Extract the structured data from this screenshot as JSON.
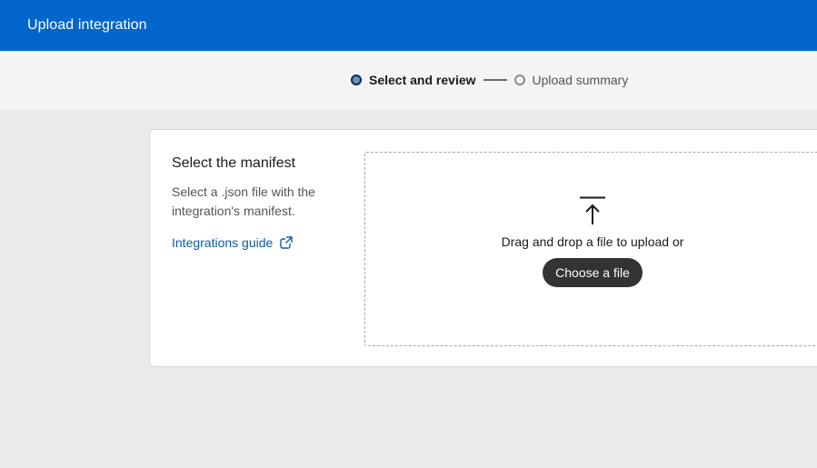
{
  "header": {
    "title": "Upload integration"
  },
  "steps": [
    {
      "label": "Select and review",
      "state": "active"
    },
    {
      "label": "Upload summary",
      "state": "inactive"
    }
  ],
  "manifest": {
    "title": "Select the manifest",
    "description": "Select a .json file with the integration's manifest.",
    "guide_link": "Integrations guide"
  },
  "dropzone": {
    "prompt": "Drag and drop a file to upload or",
    "button_label": "Choose a file"
  },
  "colors": {
    "header_bg": "#0066cc",
    "link": "#0b5cad",
    "button_bg": "#333333"
  }
}
